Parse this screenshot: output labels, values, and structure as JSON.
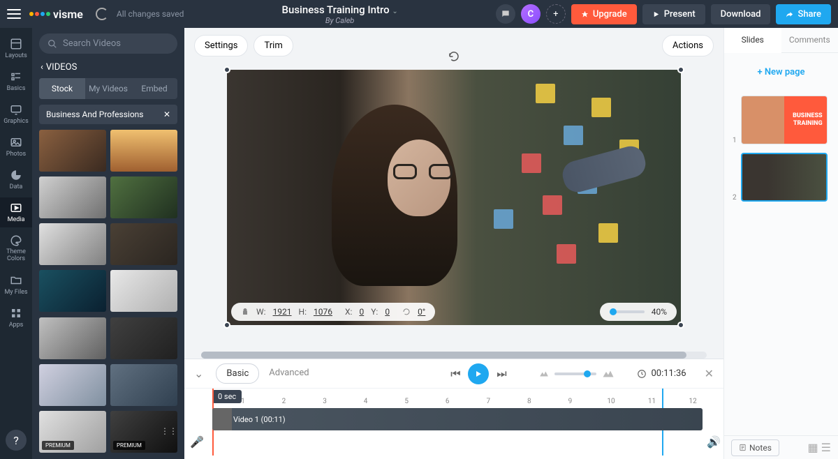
{
  "topbar": {
    "brand": "visme",
    "saved_status": "All changes saved",
    "project_title": "Business Training Intro",
    "project_author": "By Caleb",
    "avatar_initial": "C",
    "upgrade": "Upgrade",
    "present": "Present",
    "download": "Download",
    "share": "Share"
  },
  "leftbar": {
    "items": [
      {
        "label": "Layouts"
      },
      {
        "label": "Basics"
      },
      {
        "label": "Graphics"
      },
      {
        "label": "Photos"
      },
      {
        "label": "Data"
      },
      {
        "label": "Media"
      },
      {
        "label": "Theme Colors"
      },
      {
        "label": "My Files"
      },
      {
        "label": "Apps"
      }
    ],
    "help": "?"
  },
  "media_panel": {
    "search_placeholder": "Search Videos",
    "back_label": "VIDEOS",
    "tabs": {
      "stock": "Stock",
      "myvideos": "My Videos",
      "embed": "Embed"
    },
    "filter_chip": "Business And Professions",
    "premium_badge": "PREMIUM"
  },
  "canvas": {
    "settings": "Settings",
    "trim": "Trim",
    "actions": "Actions",
    "dims": {
      "w_label": "W:",
      "w": "1921",
      "h_label": "H:",
      "h": "1076",
      "x_label": "X:",
      "x": "0",
      "y_label": "Y:",
      "y": "0",
      "r_label": "0°"
    },
    "opacity": "40%"
  },
  "timeline": {
    "basic": "Basic",
    "advanced": "Advanced",
    "time": "00:11:36",
    "playhead": "0 sec",
    "marks": [
      "1",
      "2",
      "3",
      "4",
      "5",
      "6",
      "7",
      "8",
      "9",
      "10",
      "11",
      "12"
    ],
    "clip_label": "Video 1 (00:11)"
  },
  "rightpanel": {
    "tabs": {
      "slides": "Slides",
      "comments": "Comments"
    },
    "newpage": "New page",
    "slides": [
      {
        "num": "1",
        "title1": "BUSINESS",
        "title2": "TRAINING"
      },
      {
        "num": "2"
      }
    ],
    "notes": "Notes"
  }
}
